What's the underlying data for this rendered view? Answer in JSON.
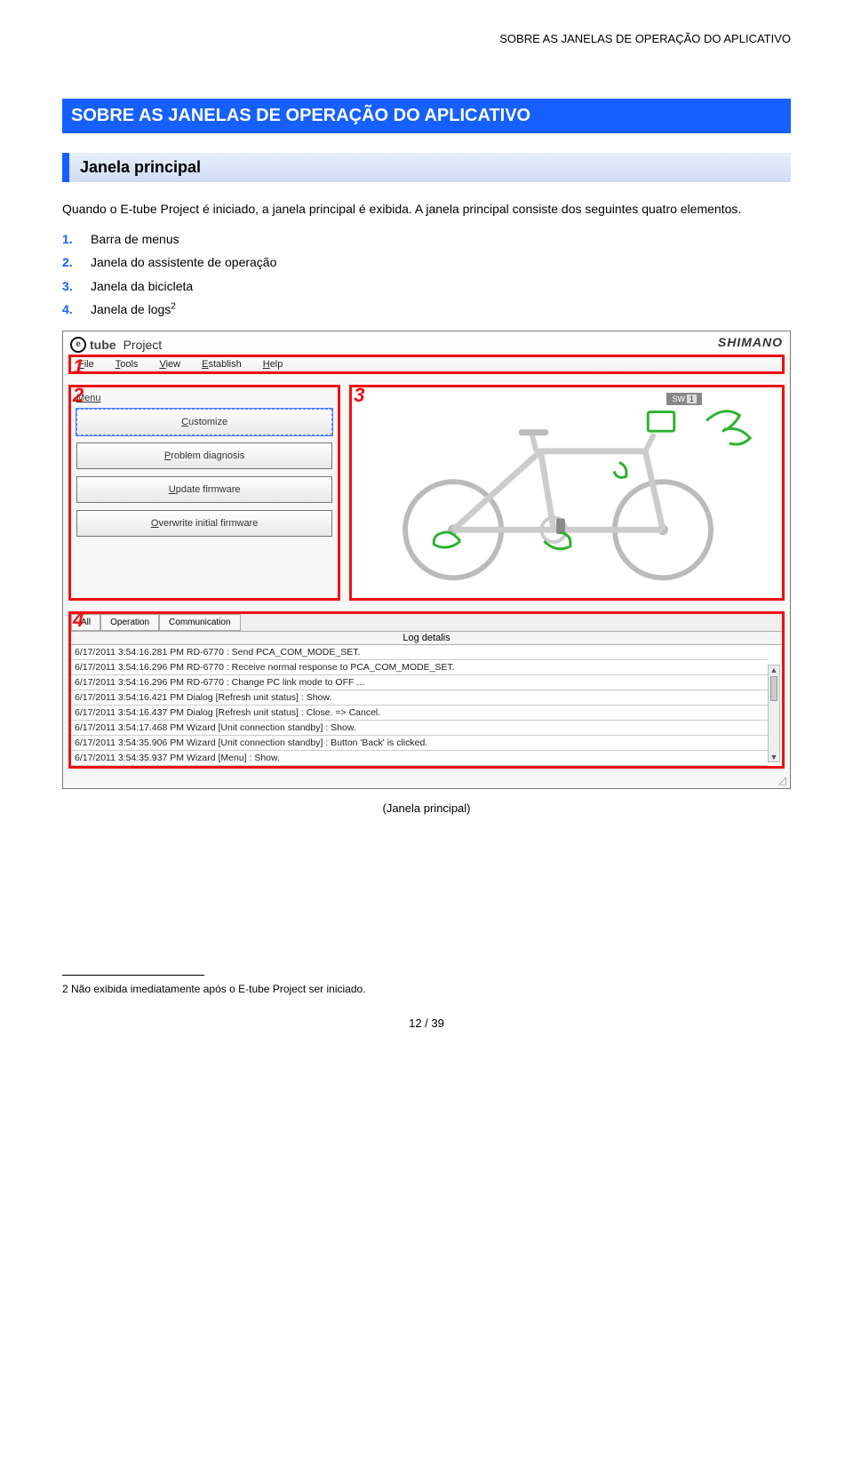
{
  "header": "SOBRE AS JANELAS DE OPERAÇÃO DO APLICATIVO",
  "main_title": "SOBRE AS JANELAS DE OPERAÇÃO DO APLICATIVO",
  "sub_title": "Janela principal",
  "intro_para": "Quando o E-tube Project é iniciado, a janela principal é exibida. A janela principal consiste dos seguintes quatro elementos.",
  "list": [
    {
      "num": "1.",
      "text": "Barra de menus"
    },
    {
      "num": "2.",
      "text": "Janela do assistente de operação"
    },
    {
      "num": "3.",
      "text": "Janela da bicicleta"
    },
    {
      "num": "4.",
      "text": "Janela de logs"
    }
  ],
  "list_super": "2",
  "app": {
    "logo_e": "e",
    "logo_tube": "tube",
    "project": "Project",
    "brand": "SHIMANO",
    "markers": {
      "m1": "1",
      "m2": "2",
      "m3": "3",
      "m4": "4"
    },
    "menubar": [
      {
        "key": "F",
        "rest": "ile"
      },
      {
        "key": "T",
        "rest": "ools"
      },
      {
        "key": "V",
        "rest": "iew"
      },
      {
        "key": "E",
        "rest": "stablish"
      },
      {
        "key": "H",
        "rest": "elp"
      }
    ],
    "menu_header": "Menu",
    "menu_buttons": [
      {
        "key": "C",
        "rest": "ustomize",
        "selected": true
      },
      {
        "key": "P",
        "rest": "roblem diagnosis",
        "selected": false
      },
      {
        "key": "U",
        "rest": "pdate firmware",
        "selected": false
      },
      {
        "key": "O",
        "rest": "verwrite initial firmware",
        "selected": false
      }
    ],
    "sw_label": "SW",
    "sw_num": "1",
    "log_tabs": [
      "All",
      "Operation",
      "Communication"
    ],
    "log_header": "Log detalis",
    "log_rows": [
      "6/17/2011 3:54:16.281 PM RD-6770 : Send PCA_COM_MODE_SET.",
      "6/17/2011 3:54:16.296 PM RD-6770 : Receive normal response to PCA_COM_MODE_SET.",
      "6/17/2011 3:54:16.296 PM RD-6770 : Change PC link mode to OFF ...",
      "6/17/2011 3:54:16.421 PM Dialog [Refresh unit status] : Show.",
      "6/17/2011 3:54:16.437 PM Dialog [Refresh unit status] : Close. => Cancel.",
      "6/17/2011 3:54:17.468 PM Wizard [Unit connection standby] : Show.",
      "6/17/2011 3:54:35.906 PM Wizard [Unit connection standby] : Button 'Back' is clicked.",
      "6/17/2011 3:54:35.937 PM Wizard [Menu] : Show."
    ]
  },
  "caption": "(Janela principal)",
  "footnote": "2  Não exibida imediatamente após o E-tube Project ser iniciado.",
  "page_number": "12 / 39"
}
